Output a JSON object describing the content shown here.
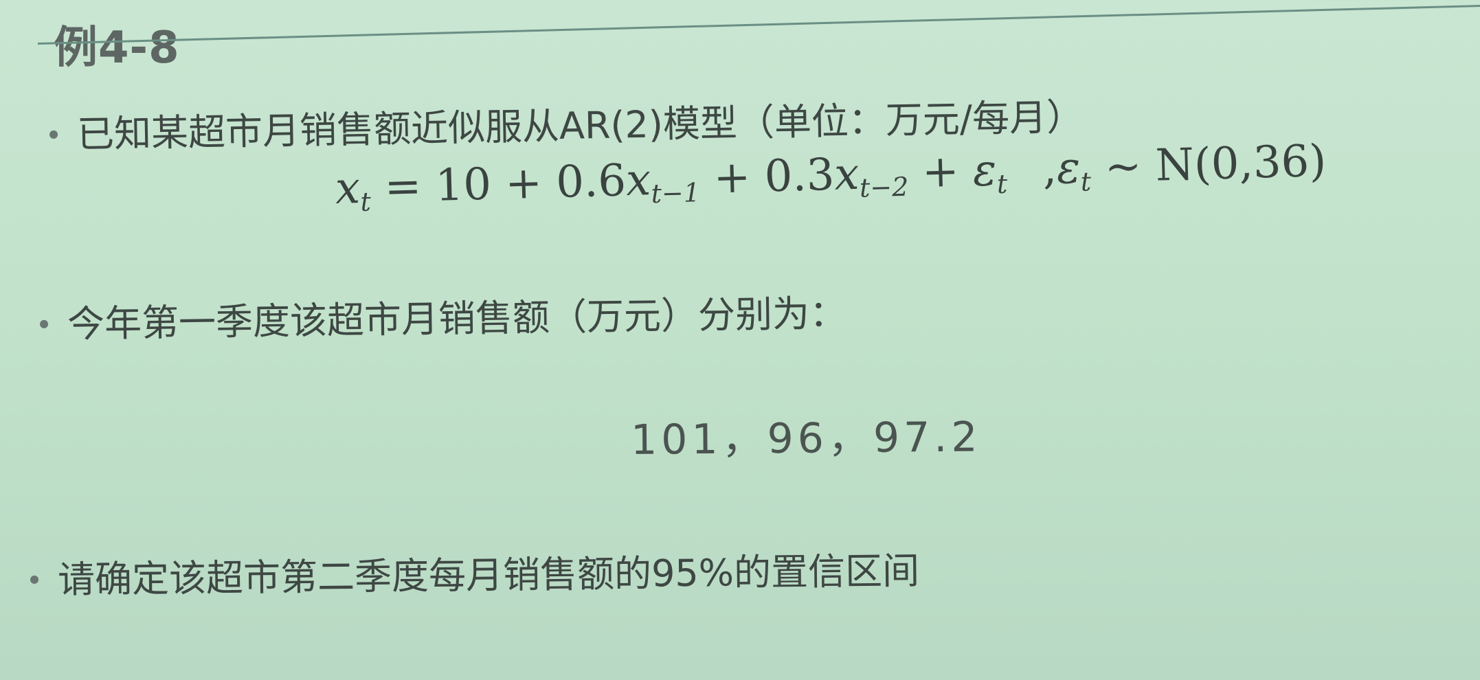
{
  "slide": {
    "title": "例4-8",
    "bullets": [
      "已知某超市月销售额近似服从AR(2)模型（单位：万元/每月）",
      "今年第一季度该超市月销售额（万元）分别为：",
      "请确定该超市第二季度每月销售额的95%的置信区间"
    ],
    "formula": {
      "x": "x",
      "t": "t",
      "eq_const": " = 10 + 0.6",
      "t_minus_1": "t−1",
      "plus_03": " + 0.3",
      "t_minus_2": "t−2",
      "plus": " + ",
      "epsilon": "ε",
      "comma": ",",
      "dist": " ~ N(0,36)"
    },
    "values": "101，96，97.2"
  }
}
